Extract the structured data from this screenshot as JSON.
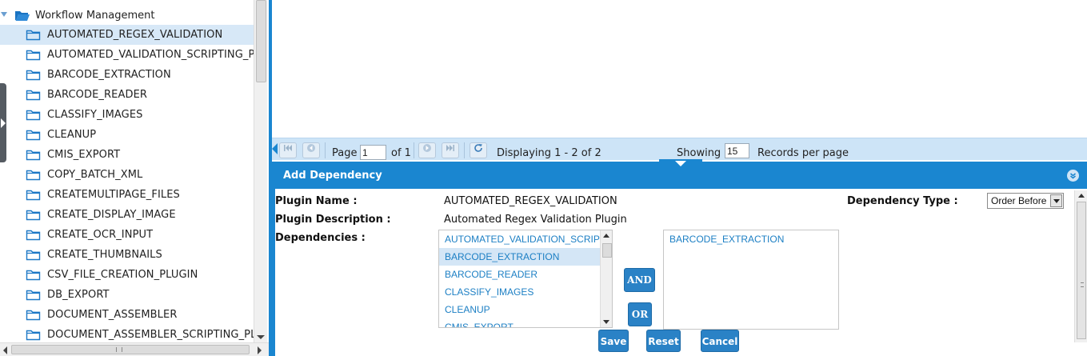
{
  "tree": {
    "root_label": "Workflow Management",
    "items": [
      {
        "label": "AUTOMATED_REGEX_VALIDATION",
        "selected": true
      },
      {
        "label": "AUTOMATED_VALIDATION_SCRIPTING_PL",
        "selected": false
      },
      {
        "label": "BARCODE_EXTRACTION",
        "selected": false
      },
      {
        "label": "BARCODE_READER",
        "selected": false
      },
      {
        "label": "CLASSIFY_IMAGES",
        "selected": false
      },
      {
        "label": "CLEANUP",
        "selected": false
      },
      {
        "label": "CMIS_EXPORT",
        "selected": false
      },
      {
        "label": "COPY_BATCH_XML",
        "selected": false
      },
      {
        "label": "CREATEMULTIPAGE_FILES",
        "selected": false
      },
      {
        "label": "CREATE_DISPLAY_IMAGE",
        "selected": false
      },
      {
        "label": "CREATE_OCR_INPUT",
        "selected": false
      },
      {
        "label": "CREATE_THUMBNAILS",
        "selected": false
      },
      {
        "label": "CSV_FILE_CREATION_PLUGIN",
        "selected": false
      },
      {
        "label": "DB_EXPORT",
        "selected": false
      },
      {
        "label": "DOCUMENT_ASSEMBLER",
        "selected": false
      },
      {
        "label": "DOCUMENT_ASSEMBLER_SCRIPTING_PL",
        "selected": false
      }
    ]
  },
  "pager": {
    "page_label": "Page",
    "page_value": "1",
    "of_label": "of 1",
    "displaying": "Displaying 1 - 2 of 2",
    "showing_label": "Showing",
    "showing_value": "15",
    "records_label": "Records per page"
  },
  "dialog": {
    "title": "Add Dependency",
    "plugin_name_label": "Plugin Name :",
    "plugin_name_value": "AUTOMATED_REGEX_VALIDATION",
    "plugin_desc_label": "Plugin Description :",
    "plugin_desc_value": "Automated Regex Validation Plugin",
    "dependencies_label": "Dependencies :",
    "dependency_type_label": "Dependency Type :",
    "dependency_type_value": "Order Before",
    "available": [
      {
        "label": "AUTOMATED_VALIDATION_SCRIPT",
        "selected": false
      },
      {
        "label": "BARCODE_EXTRACTION",
        "selected": true
      },
      {
        "label": "BARCODE_READER",
        "selected": false
      },
      {
        "label": "CLASSIFY_IMAGES",
        "selected": false
      },
      {
        "label": "CLEANUP",
        "selected": false
      },
      {
        "label": "CMIS_EXPORT",
        "selected": false
      }
    ],
    "selected_deps": [
      "BARCODE_EXTRACTION"
    ],
    "and_label": "AND",
    "or_label": "OR",
    "save_label": "Save",
    "reset_label": "Reset",
    "cancel_label": "Cancel"
  },
  "colors": {
    "accent": "#1a86d0",
    "selection": "#d7e8f7",
    "link": "#1c7fc4",
    "button": "#2a82c6"
  },
  "icons": {
    "tree_root": "open-folder-icon",
    "tree_item": "folder-icon"
  }
}
